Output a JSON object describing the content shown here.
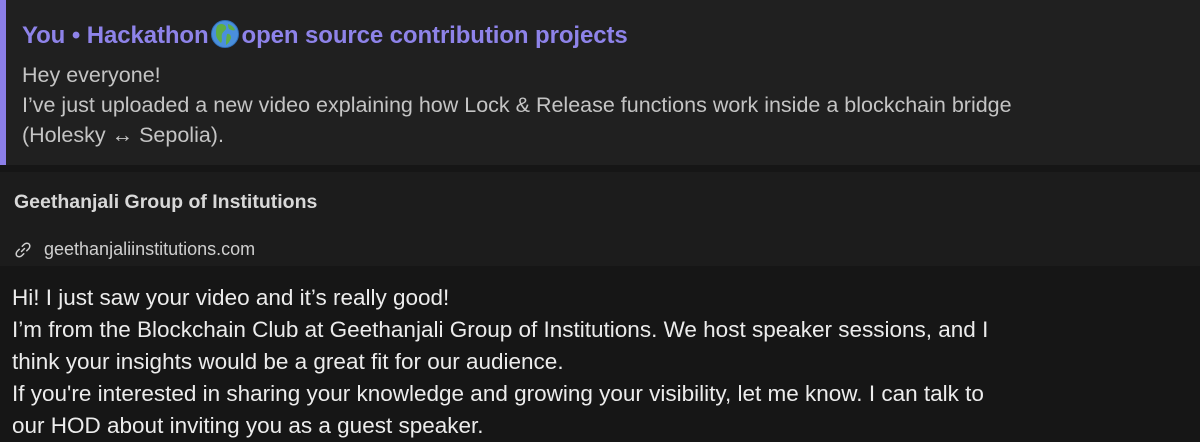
{
  "reply_quote": {
    "author": "You",
    "separator": "•",
    "channel_prefix": "Hackathon",
    "channel_emoji": "globe-americas-icon",
    "channel_suffix": "open source contribution projects",
    "lines": [
      "Hey everyone!",
      "I’ve just uploaded a new video explaining how Lock & Release functions work inside a blockchain bridge",
      "(Holesky ↔ Sepolia)."
    ],
    "accent_color": "#8b7ee8"
  },
  "link_preview": {
    "title": "Geethanjali Group of Institutions",
    "url": "geethanjaliinstitutions.com",
    "icon": "link-icon"
  },
  "message": {
    "lines": [
      "Hi! I just saw your video and it’s really good!",
      "I’m from the Blockchain Club at Geethanjali Group of Institutions. We host speaker sessions, and I",
      "think your insights would be a great fit for our audience.",
      "If you're interested in sharing your knowledge and growing your visibility, let me know. I can talk to",
      "our HOD about inviting you as a guest speaker."
    ]
  }
}
